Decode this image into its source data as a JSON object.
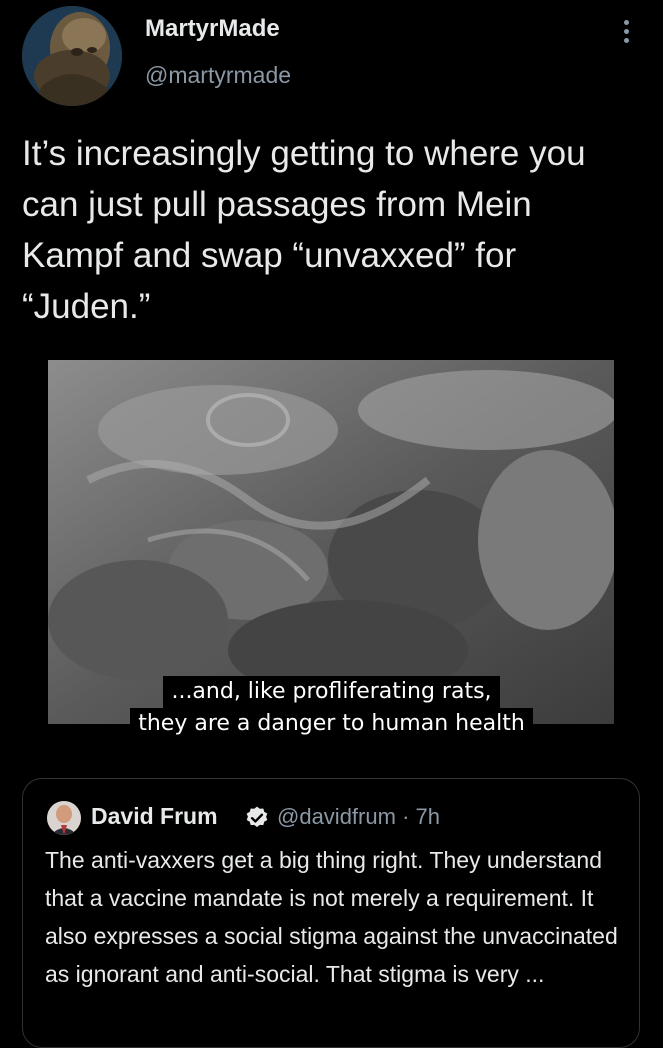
{
  "tweet": {
    "author_name": "MartyrMade",
    "author_handle": "@martyrmade",
    "text": "It’s increasingly getting to where you can just pull passages from Mein Kampf and swap “unvaxxed” for “Juden.”",
    "media": {
      "caption_line1": "...and, like profliferating rats,",
      "caption_line2": "they are a danger to human health"
    }
  },
  "quoted_tweet": {
    "author_name": "David Frum",
    "author_handle": "@davidfrum",
    "separator": "·",
    "time": "7h",
    "text": "The anti-vaxxers get a big thing right. They understand that a vaccine mandate is not merely a requirement. It also expresses a social stigma against the unvaccinated as ignorant and anti-social. That stigma is very ..."
  },
  "icons": {
    "more": "more-vertical-icon",
    "verified": "verified-badge-icon"
  },
  "colors": {
    "background": "#000000",
    "primary_text": "#e7e9ea",
    "secondary_text": "#8b98a5",
    "border": "#2f3336"
  }
}
